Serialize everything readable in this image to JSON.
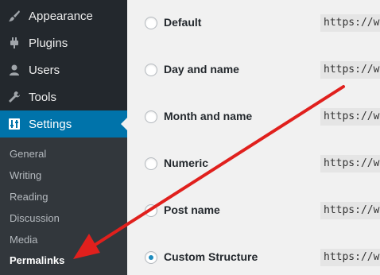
{
  "sidebar": {
    "items": [
      {
        "label": "Appearance",
        "icon": "paintbrush-icon"
      },
      {
        "label": "Plugins",
        "icon": "plugin-icon"
      },
      {
        "label": "Users",
        "icon": "user-icon"
      },
      {
        "label": "Tools",
        "icon": "wrench-icon"
      },
      {
        "label": "Settings",
        "icon": "settings-icon",
        "active": true
      }
    ],
    "submenu": [
      {
        "label": "General"
      },
      {
        "label": "Writing"
      },
      {
        "label": "Reading"
      },
      {
        "label": "Discussion"
      },
      {
        "label": "Media"
      },
      {
        "label": "Permalinks",
        "current": true
      }
    ]
  },
  "permalinks": {
    "options": [
      {
        "label": "Default",
        "example": "https://w",
        "checked": false
      },
      {
        "label": "Day and name",
        "example": "https://w",
        "checked": false
      },
      {
        "label": "Month and name",
        "example": "https://w",
        "checked": false
      },
      {
        "label": "Numeric",
        "example": "https://w",
        "checked": false
      },
      {
        "label": "Post name",
        "example": "https://w",
        "checked": false
      },
      {
        "label": "Custom Structure",
        "example": "https://w",
        "checked": true
      }
    ]
  },
  "colors": {
    "sidebar": "#23282d",
    "submenu": "#32373c",
    "active": "#0073aa",
    "annotation_arrow": "#e0201d"
  }
}
